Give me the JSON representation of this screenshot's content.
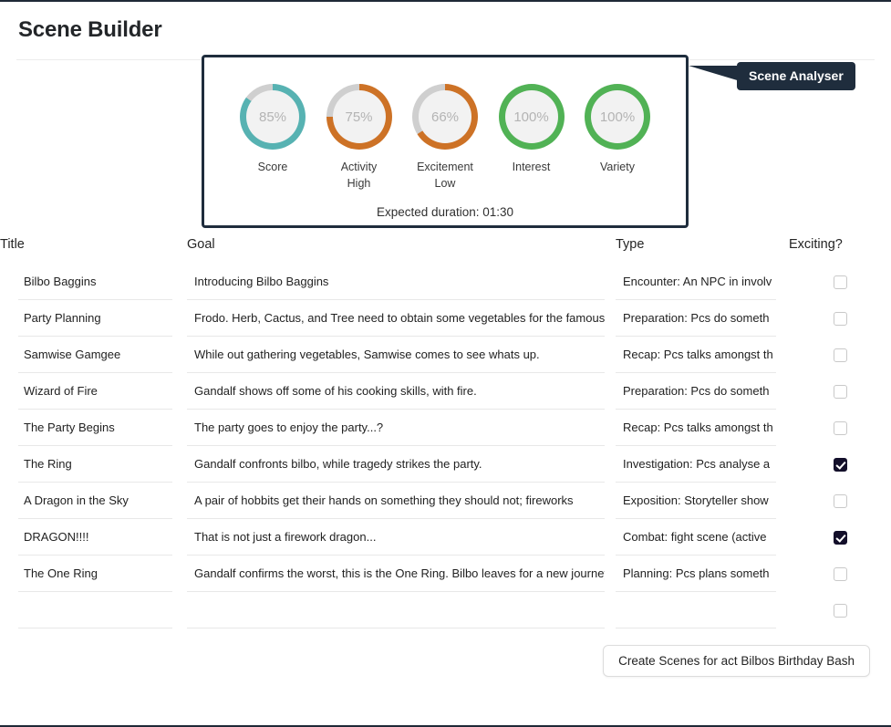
{
  "header": {
    "title": "Scene Builder"
  },
  "tooltip": {
    "label": "Scene Analyser"
  },
  "analyser": {
    "duration": "Expected duration: 01:30",
    "gauges": [
      {
        "value": "85%",
        "percent": 85,
        "label": "Score",
        "sub": "",
        "color": "#57b2b2"
      },
      {
        "value": "75%",
        "percent": 75,
        "label": "Activity",
        "sub": "High",
        "color": "#cd7226"
      },
      {
        "value": "66%",
        "percent": 66,
        "label": "Excitement",
        "sub": "Low",
        "color": "#cd7226"
      },
      {
        "value": "100%",
        "percent": 100,
        "label": "Interest",
        "sub": "",
        "color": "#51b255"
      },
      {
        "value": "100%",
        "percent": 100,
        "label": "Variety",
        "sub": "",
        "color": "#51b255"
      }
    ],
    "track_color": "#cfcfcf",
    "frame_color": "#1f2d3d"
  },
  "table": {
    "columns": [
      "Title",
      "Goal",
      "Type",
      "Exciting?"
    ],
    "rows": [
      {
        "title": "Bilbo Baggins",
        "goal": "Introducing Bilbo Baggins",
        "type": "Encounter: An NPC in involv",
        "exciting": false
      },
      {
        "title": "Party Planning",
        "goal": "Frodo. Herb, Cactus, and Tree need to obtain some vegetables for the famous Ba",
        "type": "Preparation: Pcs do someth",
        "exciting": false
      },
      {
        "title": "Samwise Gamgee",
        "goal": "While out gathering vegetables, Samwise comes to see whats up.",
        "type": "Recap: Pcs talks amongst th",
        "exciting": false
      },
      {
        "title": "Wizard of Fire",
        "goal": "Gandalf shows off some of his cooking skills, with fire.",
        "type": "Preparation: Pcs do someth",
        "exciting": false
      },
      {
        "title": "The Party Begins",
        "goal": "The party goes to enjoy the party...?",
        "type": "Recap: Pcs talks amongst th",
        "exciting": false
      },
      {
        "title": "The Ring",
        "goal": "Gandalf confronts bilbo, while tragedy strikes the party.",
        "type": "Investigation: Pcs analyse a",
        "exciting": true
      },
      {
        "title": "A Dragon in the Sky",
        "goal": "A pair of hobbits get their hands on something they should not; fireworks",
        "type": "Exposition: Storyteller show",
        "exciting": false
      },
      {
        "title": "DRAGON!!!!",
        "goal": "That is not just a firework dragon...",
        "type": "Combat: fight scene (active",
        "exciting": true
      },
      {
        "title": "The One Ring",
        "goal": "Gandalf confirms the worst, this is the One Ring. Bilbo leaves for a new journey, a",
        "type": "Planning: Pcs plans someth",
        "exciting": false
      },
      {
        "title": "",
        "goal": "",
        "type": "",
        "exciting": false
      }
    ]
  },
  "footer": {
    "create_button": "Create Scenes for act Bilbos Birthday Bash"
  }
}
